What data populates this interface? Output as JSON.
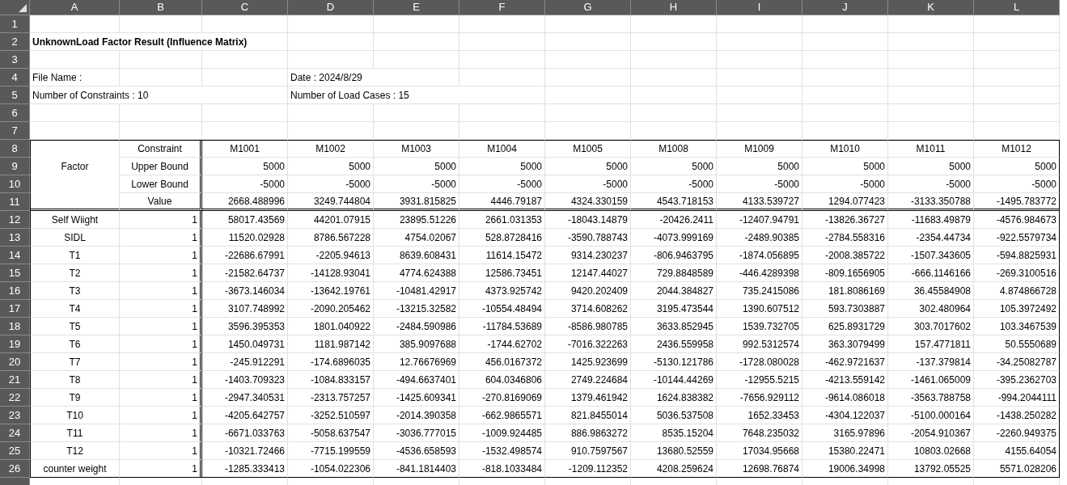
{
  "sheet": {
    "column_headers": [
      "A",
      "B",
      "C",
      "D",
      "E",
      "F",
      "G",
      "H",
      "I",
      "J",
      "K",
      "L"
    ],
    "row_numbers": [
      "1",
      "2",
      "3",
      "4",
      "5",
      "6",
      "7",
      "8",
      "9",
      "10",
      "11",
      "12",
      "13",
      "14",
      "15",
      "16",
      "17",
      "18",
      "19",
      "20",
      "21",
      "22",
      "23",
      "24",
      "25",
      "26"
    ]
  },
  "title": "UnknownLoad Factor Result (Influence Matrix)",
  "file_name_label": "File Name :",
  "date": "Date : 2024/8/29",
  "constraints_count": "Number of Constraints : 10",
  "load_cases_count": "Number of Load Cases : 15",
  "table": {
    "factor_label": "Factor",
    "header_labels": [
      "Constraint",
      "Upper Bound",
      "Lower Bound",
      "Value"
    ],
    "constraints": [
      {
        "name": "M1001",
        "upper": "5000",
        "lower": "-5000",
        "value": "2668.488996"
      },
      {
        "name": "M1002",
        "upper": "5000",
        "lower": "-5000",
        "value": "3249.744804"
      },
      {
        "name": "M1003",
        "upper": "5000",
        "lower": "-5000",
        "value": "3931.815825"
      },
      {
        "name": "M1004",
        "upper": "5000",
        "lower": "-5000",
        "value": "4446.79187"
      },
      {
        "name": "M1005",
        "upper": "5000",
        "lower": "-5000",
        "value": "4324.330159"
      },
      {
        "name": "M1008",
        "upper": "5000",
        "lower": "-5000",
        "value": "4543.718153"
      },
      {
        "name": "M1009",
        "upper": "5000",
        "lower": "-5000",
        "value": "4133.539727"
      },
      {
        "name": "M1010",
        "upper": "5000",
        "lower": "-5000",
        "value": "1294.077423"
      },
      {
        "name": "M1011",
        "upper": "5000",
        "lower": "-5000",
        "value": "-3133.350788"
      },
      {
        "name": "M1012",
        "upper": "5000",
        "lower": "-5000",
        "value": "-1495.783772"
      }
    ],
    "rows": [
      {
        "name": "Self Wiight",
        "factor": "1",
        "values": [
          "58017.43569",
          "44201.07915",
          "23895.51226",
          "2661.031353",
          "-18043.14879",
          "-20426.2411",
          "-12407.94791",
          "-13826.36727",
          "-11683.49879",
          "-4576.984673"
        ]
      },
      {
        "name": "SIDL",
        "factor": "1",
        "values": [
          "11520.02928",
          "8786.567228",
          "4754.02067",
          "528.8728416",
          "-3590.788743",
          "-4073.999169",
          "-2489.90385",
          "-2784.558316",
          "-2354.44734",
          "-922.5579734"
        ]
      },
      {
        "name": "T1",
        "factor": "1",
        "values": [
          "-22686.67991",
          "-2205.94613",
          "8639.608431",
          "11614.15472",
          "9314.230237",
          "-806.9463795",
          "-1874.056895",
          "-2008.385722",
          "-1507.343605",
          "-594.8825931"
        ]
      },
      {
        "name": "T2",
        "factor": "1",
        "values": [
          "-21582.64737",
          "-14128.93041",
          "4774.624388",
          "12586.73451",
          "12147.44027",
          "729.8848589",
          "-446.4289398",
          "-809.1656905",
          "-666.1146166",
          "-269.3100516"
        ]
      },
      {
        "name": "T3",
        "factor": "1",
        "values": [
          "-3673.146034",
          "-13642.19761",
          "-10481.42917",
          "4373.925742",
          "9420.202409",
          "2044.384827",
          "735.2415086",
          "181.8086169",
          "36.45584908",
          "4.874866728"
        ]
      },
      {
        "name": "T4",
        "factor": "1",
        "values": [
          "3107.748992",
          "-2090.205462",
          "-13215.32582",
          "-10554.48494",
          "3714.608262",
          "3195.473544",
          "1390.607512",
          "593.7303887",
          "302.480964",
          "105.3972492"
        ]
      },
      {
        "name": "T5",
        "factor": "1",
        "values": [
          "3596.395353",
          "1801.040922",
          "-2484.590986",
          "-11784.53689",
          "-8586.980785",
          "3633.852945",
          "1539.732705",
          "625.8931729",
          "303.7017602",
          "103.3467539"
        ]
      },
      {
        "name": "T6",
        "factor": "1",
        "values": [
          "1450.049731",
          "1181.987142",
          "385.9097688",
          "-1744.62702",
          "-7016.322263",
          "2436.559958",
          "992.5312574",
          "363.3079499",
          "157.4771811",
          "50.5550689"
        ]
      },
      {
        "name": "T7",
        "factor": "1",
        "values": [
          "-245.912291",
          "-174.6896035",
          "12.76676969",
          "456.0167372",
          "1425.923699",
          "-5130.121786",
          "-1728.080028",
          "-462.9721637",
          "-137.379814",
          "-34.25082787"
        ]
      },
      {
        "name": "T8",
        "factor": "1",
        "values": [
          "-1403.709323",
          "-1084.833157",
          "-494.6637401",
          "604.0346806",
          "2749.224684",
          "-10144.44269",
          "-12955.5215",
          "-4213.559142",
          "-1461.065009",
          "-395.2362703"
        ]
      },
      {
        "name": "T9",
        "factor": "1",
        "values": [
          "-2947.340531",
          "-2313.757257",
          "-1425.609341",
          "-270.8169069",
          "1379.461942",
          "1624.838382",
          "-7656.929112",
          "-9614.086018",
          "-3563.788758",
          "-994.2044111"
        ]
      },
      {
        "name": "T10",
        "factor": "1",
        "values": [
          "-4205.642757",
          "-3252.510597",
          "-2014.390358",
          "-662.9865571",
          "821.8455014",
          "5036.537508",
          "1652.33453",
          "-4304.122037",
          "-5100.000164",
          "-1438.250282"
        ]
      },
      {
        "name": "T11",
        "factor": "1",
        "values": [
          "-6671.033763",
          "-5058.637547",
          "-3036.777015",
          "-1009.924485",
          "886.9863272",
          "8535.15204",
          "7648.235032",
          "3165.97896",
          "-2054.910367",
          "-2260.949375"
        ]
      },
      {
        "name": "T12",
        "factor": "1",
        "values": [
          "-10321.72466",
          "-7715.199559",
          "-4536.658593",
          "-1532.498574",
          "910.7597567",
          "13680.52559",
          "17034.95668",
          "15380.22471",
          "10803.02668",
          "4155.64054"
        ]
      },
      {
        "name": "counter weight",
        "factor": "1",
        "values": [
          "-1285.333413",
          "-1054.022306",
          "-841.1814403",
          "-818.1033484",
          "-1209.112352",
          "4208.259624",
          "12698.76874",
          "19006.34998",
          "13792.05525",
          "5571.028206"
        ]
      }
    ]
  }
}
